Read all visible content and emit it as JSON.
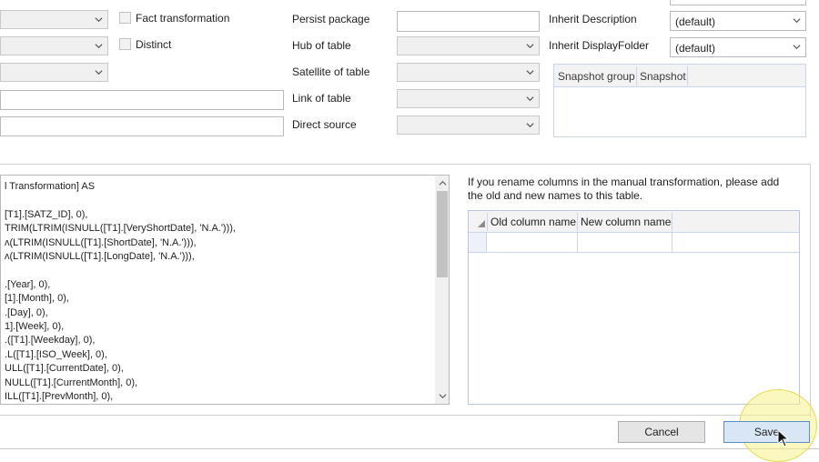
{
  "top_left": {
    "fact_transformation_label": "Fact transformation",
    "distinct_label": "Distinct"
  },
  "top_middle": {
    "persist_package_label": "Persist package",
    "hub_of_table_label": "Hub of table",
    "satellite_of_table_label": "Satellite of table",
    "link_of_table_label": "Link of table",
    "direct_source_label": "Direct source"
  },
  "top_right": {
    "inherit_description_label": "Inherit Description",
    "inherit_description_value": "(default)",
    "inherit_displayfolder_label": "Inherit DisplayFolder",
    "inherit_displayfolder_value": "(default)",
    "snapshot_grid": {
      "columns": [
        "Snapshot group",
        "Snapshot"
      ]
    }
  },
  "code_editor": {
    "lines": [
      "l Transformation] AS",
      "",
      "[T1].[SATZ_ID], 0),",
      "TRIM(LTRIM(ISNULL([T1].[VeryShortDate], 'N.A.'))),",
      "ʌ(LTRIM(ISNULL([T1].[ShortDate], 'N.A.'))),",
      "ʌ(LTRIM(ISNULL([T1].[LongDate], 'N.A.'))),",
      "",
      ".[Year], 0),",
      "[1].[Month], 0),",
      ".[Day], 0),",
      "1].[Week], 0),",
      ".([T1].[Weekday], 0),",
      ".L([T1].[ISO_Week], 0),",
      "ULL([T1].[CurrentDate], 0),",
      "NULL([T1].[CurrentMonth], 0),",
      "ILL([T1].[PrevMonth], 0),"
    ]
  },
  "rename_panel": {
    "help_text": "If you rename columns in the manual transformation, please add the old and new names to this table.",
    "columns": [
      "Old column name",
      "New column name"
    ]
  },
  "footer": {
    "cancel_label": "Cancel",
    "save_label": "Save"
  },
  "colors": {
    "accent": "#5a8ec9",
    "highlight": "#f5f08a"
  }
}
